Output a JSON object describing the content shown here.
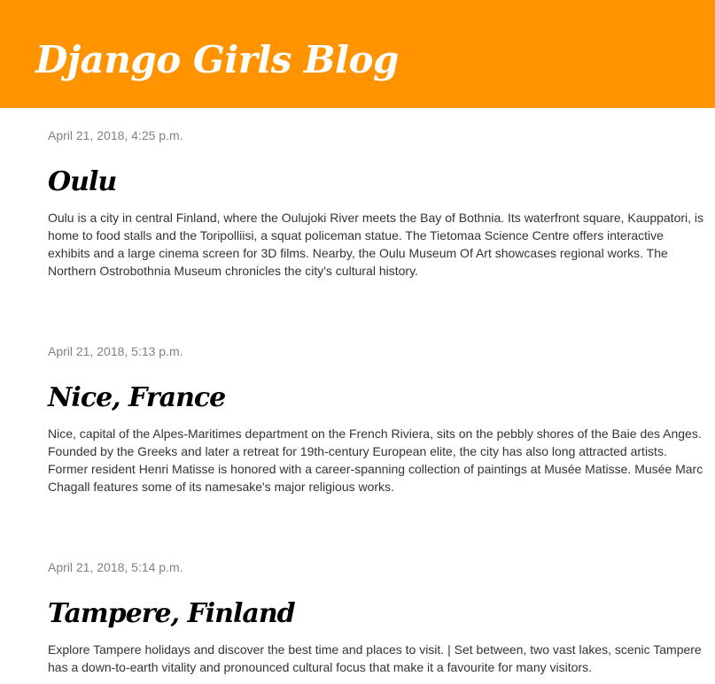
{
  "header": {
    "title": "Django Girls Blog"
  },
  "posts": [
    {
      "date": "April 21, 2018, 4:25 p.m.",
      "title": "Oulu",
      "body": "Oulu is a city in central Finland, where the Oulujoki River meets the Bay of Bothnia. Its waterfront square, Kauppatori, is home to food stalls and the Toripolliisi, a squat policeman statue. The Tietomaa Science Centre offers interactive exhibits and a large cinema screen for 3D films. Nearby, the Oulu Museum Of Art showcases regional works. The Northern Ostrobothnia Museum chronicles the city's cultural history."
    },
    {
      "date": "April 21, 2018, 5:13 p.m.",
      "title": "Nice, France",
      "body": "Nice, capital of the Alpes-Maritimes department on the French Riviera, sits on the pebbly shores of the Baie des Anges. Founded by the Greeks and later a retreat for 19th-century European elite, the city has also long attracted artists. Former resident Henri Matisse is honored with a career-spanning collection of paintings at Musée Matisse. Musée Marc Chagall features some of its namesake's major religious works."
    },
    {
      "date": "April 21, 2018, 5:14 p.m.",
      "title": "Tampere, Finland",
      "body": "Explore Tampere holidays and discover the best time and places to visit. | Set between, two vast lakes, scenic Tampere has a down-to-earth vitality and pronounced cultural focus that make it a favourite for many visitors."
    }
  ],
  "colors": {
    "header_background": "#ff9400",
    "header_text": "#ffffff",
    "date_text": "#828282",
    "title_text": "#000000",
    "body_text": "#333333"
  }
}
